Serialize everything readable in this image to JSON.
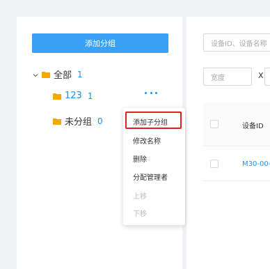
{
  "left": {
    "add_group_button": "添加分组",
    "tree": [
      {
        "label": "全部",
        "count": "1"
      },
      {
        "label": "123",
        "count": "1"
      },
      {
        "label": "未分组",
        "count": "0"
      }
    ]
  },
  "context_menu": {
    "items": [
      {
        "label": "添加子分组",
        "disabled": false
      },
      {
        "label": "修改名称",
        "disabled": false
      },
      {
        "label": "删除",
        "disabled": false
      },
      {
        "label": "分配管理者",
        "disabled": false
      },
      {
        "label": "上移",
        "disabled": true
      },
      {
        "label": "下移",
        "disabled": true
      }
    ]
  },
  "right": {
    "search_placeholder": "设备ID、设备名称",
    "width_placeholder": "宽度",
    "x_sep": "X",
    "column_device_id": "设备ID",
    "row_device_id": "M30-00-"
  },
  "colors": {
    "accent": "#3ba1f7",
    "link": "#1890ff",
    "folder": "#f7a800",
    "highlight": "#e02020"
  }
}
